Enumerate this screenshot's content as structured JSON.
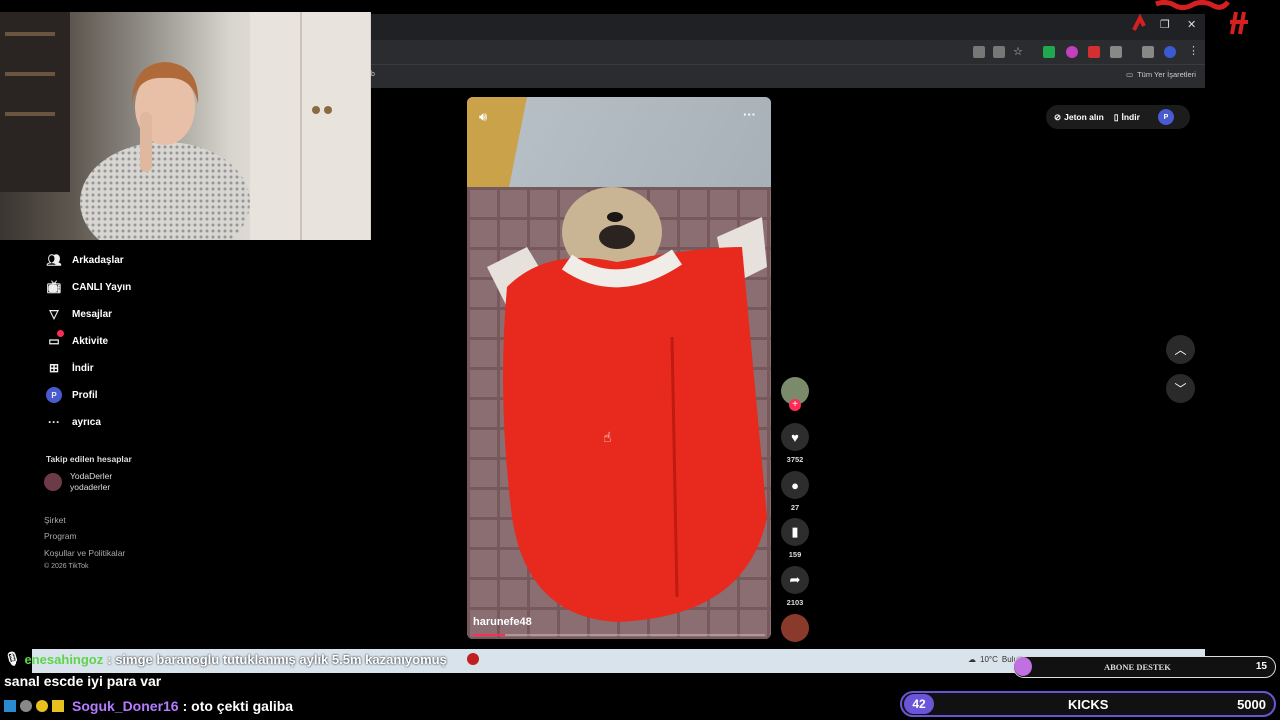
{
  "browser": {
    "bookmarks_folder_label": "Tüm Yer İşaretleri",
    "bookmark_truncated": "b"
  },
  "sidebar": {
    "items": [
      {
        "label": "Arkadaşlar",
        "icon": "friends-icon"
      },
      {
        "label": "CANLI Yayın",
        "icon": "live-icon"
      },
      {
        "label": "Mesajlar",
        "icon": "messages-icon"
      },
      {
        "label": "Aktivite",
        "icon": "activity-icon"
      },
      {
        "label": "İndir",
        "icon": "download-icon"
      },
      {
        "label": "Profil",
        "icon": "profile-icon",
        "avatar_letter": "P"
      },
      {
        "label": "ayrıca",
        "icon": "more-icon"
      }
    ],
    "followed_heading": "Takip edilen hesaplar",
    "followed": {
      "display": "YodaDerler",
      "handle": "yodaderler"
    },
    "footer": [
      "Şirket",
      "Program",
      "Koşullar ve Politikalar",
      "© 2026 TikTok"
    ]
  },
  "topbar": {
    "coins_label": "Jeton alın",
    "download_label": "İndir",
    "avatar_letter": "P"
  },
  "video": {
    "username": "harunefe48",
    "menu": "···"
  },
  "actions": {
    "likes": "3752",
    "comments": "27",
    "saves": "159",
    "shares": "2103"
  },
  "chat": {
    "ticker_user": "enesahingoz",
    "ticker_text": ": simge baranoglu tutuklanmış aylık 5.5m kazanıyomuş",
    "line2": "sanal escde iyi para var",
    "line3_user": "Soguk_Doner16",
    "line3_text": ": oto çekti galiba"
  },
  "taskbar": {
    "weather": "10°C",
    "weather_desc": "Bulutlu"
  },
  "overlay": {
    "abone_label": "ABONE DESTEK",
    "abone_count": "15",
    "kicks_count": "42",
    "kicks_label": "KICKS",
    "kicks_goal": "5000"
  },
  "colors": {
    "accent_red": "#fe2c55",
    "chat_user_green": "#5fd44a",
    "chat_user_purple": "#b57cff",
    "kicks_badge": "#6a55d8"
  }
}
